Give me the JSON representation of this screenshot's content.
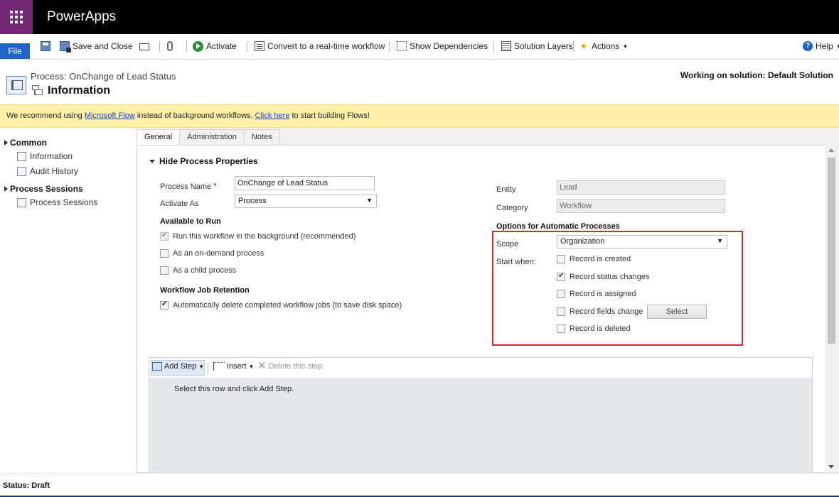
{
  "app": {
    "name": "PowerApps"
  },
  "ribbon": {
    "file": "File",
    "save_close": "Save and Close",
    "activate": "Activate",
    "convert": "Convert to a real-time workflow",
    "show_dependencies": "Show Dependencies",
    "solution_layers": "Solution Layers",
    "actions": "Actions",
    "help": "Help"
  },
  "header": {
    "breadcrumb": "Process: OnChange of Lead Status",
    "title": "Information",
    "solution": "Working on solution: Default Solution"
  },
  "notification": {
    "pre": "We recommend using ",
    "link1": "Microsoft Flow",
    "mid": " instead of background workflows. ",
    "link2": "Click here",
    "post": " to start building Flows!"
  },
  "nav": {
    "common": "Common",
    "items_common": [
      "Information",
      "Audit History"
    ],
    "process_sessions": "Process Sessions",
    "items_sessions": [
      "Process Sessions"
    ]
  },
  "tabs": [
    "General",
    "Administration",
    "Notes"
  ],
  "form": {
    "section_title": "Hide Process Properties",
    "process_name_label": "Process Name",
    "required_mark": "*",
    "process_name_value": "OnChange of Lead Status",
    "activate_as_label": "Activate As",
    "activate_as_value": "Process",
    "available_to_run": "Available to Run",
    "run_background": "Run this workflow in the background (recommended)",
    "on_demand": "As an on-demand process",
    "child_process": "As a child process",
    "job_retention": "Workflow Job Retention",
    "auto_delete": "Automatically delete completed workflow jobs (to save disk space)",
    "entity_label": "Entity",
    "entity_value": "Lead",
    "category_label": "Category",
    "category_value": "Workflow",
    "options_title": "Options for Automatic Processes",
    "scope_label": "Scope",
    "scope_value": "Organization",
    "start_when_label": "Start when:",
    "start_options": [
      "Record is created",
      "Record status changes",
      "Record is assigned",
      "Record fields change",
      "Record is deleted"
    ],
    "select_button": "Select"
  },
  "checks": {
    "run_background": true,
    "on_demand": false,
    "child_process": false,
    "auto_delete": true,
    "record_created": false,
    "status_changes": true,
    "record_assigned": false,
    "fields_change": false,
    "record_deleted": false
  },
  "steps": {
    "add_step": "Add Step",
    "insert": "Insert",
    "delete": "Delete this step.",
    "message": "Select this row and click Add Step."
  },
  "status": {
    "text": "Status: Draft"
  },
  "colors": {
    "brand": "#742774",
    "file": "#1f64c8",
    "highlight": "#d9262f",
    "notification": "#fff2a8"
  }
}
